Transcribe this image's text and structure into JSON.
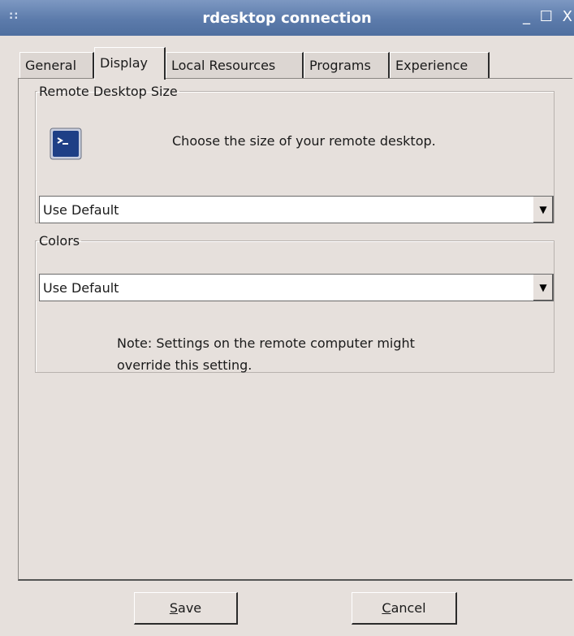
{
  "window": {
    "title": "rdesktop connection",
    "grip": "::",
    "controls": {
      "minimize": "_",
      "maximize": "☐",
      "close": "X"
    }
  },
  "tabs": [
    {
      "label": "General",
      "active": false
    },
    {
      "label": "Display",
      "active": true
    },
    {
      "label": "Local Resources",
      "active": false
    },
    {
      "label": "Programs",
      "active": false
    },
    {
      "label": "Experience",
      "active": false
    }
  ],
  "size_group": {
    "legend": "Remote Desktop Size",
    "icon": "terminal-icon",
    "prompt": "Choose the size of your remote desktop.",
    "select_value": "Use Default"
  },
  "colors_group": {
    "legend": "Colors",
    "select_value": "Use Default",
    "note_line1": "Note: Settings on the remote computer might",
    "note_line2": "override this setting."
  },
  "buttons": {
    "save_label": "Save",
    "save_mnemonic": "S",
    "save_rest": "ave",
    "cancel_label": "Cancel",
    "cancel_mnemonic": "C",
    "cancel_rest": "ancel"
  },
  "colors": {
    "titlebar": "#5c7bab",
    "window_bg": "#e6e0dc",
    "icon_blue": "#1e3f86"
  }
}
